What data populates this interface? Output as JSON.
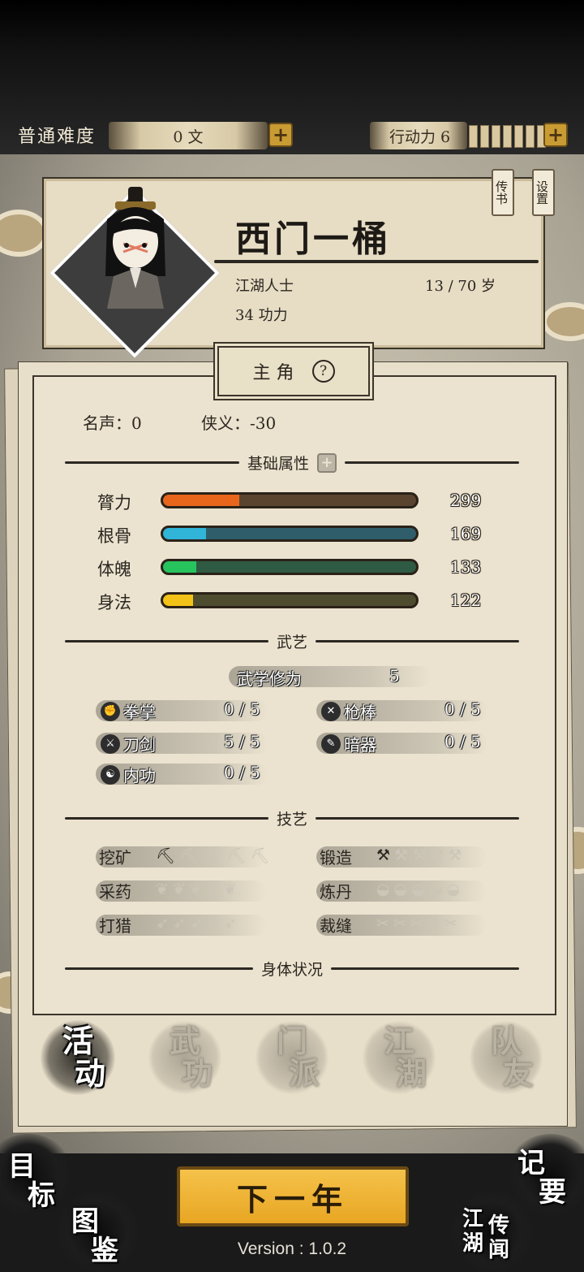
{
  "top_bar": {
    "difficulty": "普通难度",
    "money": "0 文",
    "action_points_label": "行动力 6",
    "action_points_segments": 7,
    "plus_symbol": "+"
  },
  "profile": {
    "name": "西门一桶",
    "origin": "江湖人士",
    "age": "13 / 70 岁",
    "merit": "34 功力",
    "tag_letters": "传书",
    "tag_settings": "设置"
  },
  "panel": {
    "title": "主 角",
    "help": "?",
    "fame": "名声：0",
    "chivalry": "侠义：-30",
    "basic_title": "基础属性",
    "attributes": [
      {
        "label": "膂力",
        "value": "299",
        "fill_pct": 30,
        "color": "#e8661c",
        "track": "#5a4430"
      },
      {
        "label": "根骨",
        "value": "169",
        "fill_pct": 17,
        "color": "#30b4d8",
        "track": "#2f5d6a"
      },
      {
        "label": "体魄",
        "value": "133",
        "fill_pct": 13,
        "color": "#27c45e",
        "track": "#2f5a43"
      },
      {
        "label": "身法",
        "value": "122",
        "fill_pct": 12,
        "color": "#f2c218",
        "track": "#4d4c2e"
      }
    ],
    "martial_title": "武艺",
    "martial_level_label": "武学修为",
    "martial_level_value": "5",
    "martial": [
      {
        "label": "拳掌",
        "value": "0 / 5",
        "icon": "fist-icon",
        "glyph": "✊"
      },
      {
        "label": "枪棒",
        "value": "0 / 5",
        "icon": "spear-icon",
        "glyph": "✕"
      },
      {
        "label": "刀剑",
        "value": "5 / 5",
        "icon": "sword-icon",
        "glyph": "⚔"
      },
      {
        "label": "暗器",
        "value": "0 / 5",
        "icon": "dart-icon",
        "glyph": "✎"
      },
      {
        "label": "内功",
        "value": "0 / 5",
        "icon": "inner-power-icon",
        "glyph": "☯"
      }
    ],
    "craft_title": "技艺",
    "crafts": [
      {
        "label": "挖矿",
        "level": 1,
        "glyph": "⛏",
        "icon": "pickaxe-icon"
      },
      {
        "label": "锻造",
        "level": 1,
        "glyph": "⚒",
        "icon": "anvil-icon"
      },
      {
        "label": "采药",
        "level": 0,
        "glyph": "❦",
        "icon": "herb-icon"
      },
      {
        "label": "炼丹",
        "level": 0,
        "glyph": "◒",
        "icon": "cauldron-icon"
      },
      {
        "label": "打猎",
        "level": 0,
        "glyph": "➶",
        "icon": "bow-icon"
      },
      {
        "label": "裁缝",
        "level": 0,
        "glyph": "✂",
        "icon": "needle-icon"
      }
    ],
    "body_title": "身体状况"
  },
  "tabs": [
    {
      "top": "活",
      "bottom": "动",
      "active": true
    },
    {
      "top": "武",
      "bottom": "功",
      "active": false
    },
    {
      "top": "门",
      "bottom": "派",
      "active": false
    },
    {
      "top": "江",
      "bottom": "湖",
      "active": false
    },
    {
      "top": "队",
      "bottom": "友",
      "active": false
    }
  ],
  "corners": {
    "goal_1": "目",
    "goal_2": "标",
    "atlas_1": "图",
    "atlas_2": "鉴",
    "notes_1": "记",
    "notes_2": "要",
    "rumor_1": "江",
    "rumor_2": "湖",
    "rumor_3": "传",
    "rumor_4": "闻"
  },
  "next_year": "下一年",
  "version": "Version : 1.0.2"
}
